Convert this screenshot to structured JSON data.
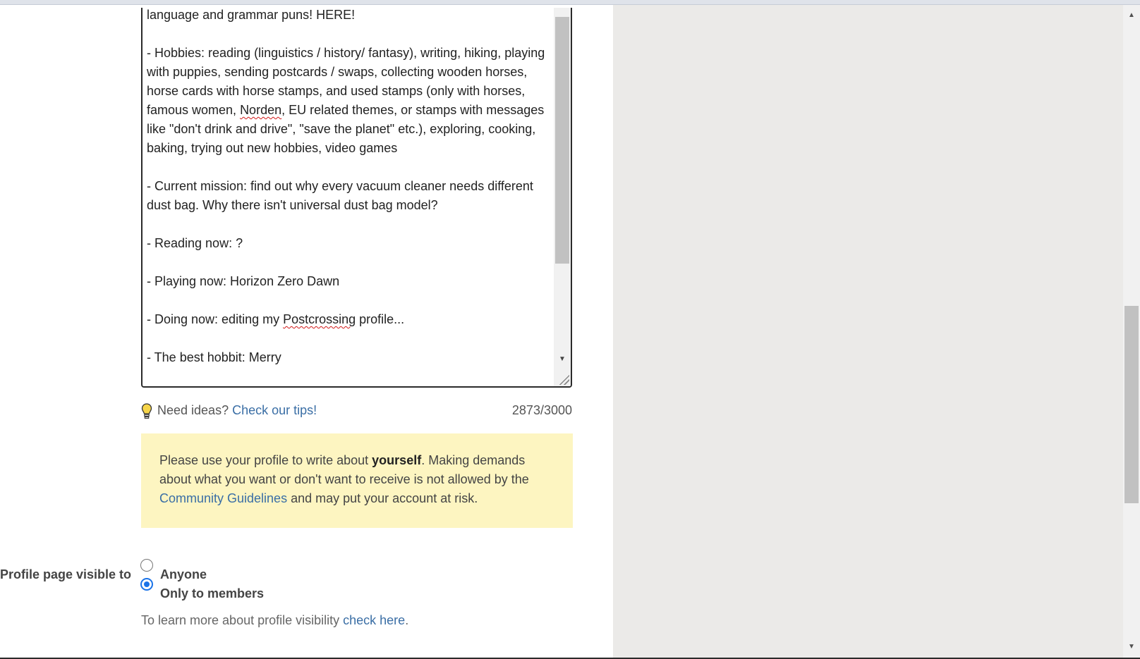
{
  "about_textarea": {
    "lines": [
      "language and grammar puns! HERE!",
      "",
      "- Hobbies: reading (linguistics / history/ fantasy), writing, hiking, playing",
      "with puppies, sending postcards / swaps, collecting wooden horses,",
      "horse cards with horse stamps, and used stamps (only with horses,"
    ],
    "line_famous_prefix": "famous women, ",
    "line_famous_misspelled": "Norden",
    "line_famous_suffix": ", EU related themes, or stamps with messages",
    "lines_2": [
      "like \"don't drink and drive\", \"save the planet\" etc.), exploring, cooking,",
      "baking, trying out new hobbies, video games",
      "",
      "- Current mission: find out why every vacuum cleaner needs different",
      "dust bag. Why there isn't universal dust bag model?",
      "",
      "- Reading now: ?",
      "",
      "- Playing now: Horizon Zero Dawn",
      ""
    ],
    "line_doing_prefix": "- Doing now: editing my ",
    "line_doing_misspelled": "Postcrossing",
    "line_doing_suffix": " profile...",
    "lines_3": [
      "",
      "- The best hobbit: Merry"
    ]
  },
  "hint": {
    "prefix": "Need ideas?",
    "link": "Check our tips!",
    "char_count": "2873/3000",
    "icon": "lightbulb-icon"
  },
  "notice": {
    "text_1": "Please use your profile to write about ",
    "text_bold": "yourself",
    "text_2": ". Making demands about what you want or don't want to receive is not allowed by the ",
    "link": "Community Guidelines",
    "text_3": " and may put your account at risk.",
    "background": "#fdf5c1"
  },
  "visibility": {
    "label": "Profile page visible to",
    "options": [
      {
        "label": "Anyone",
        "selected": false
      },
      {
        "label": "Only to members",
        "selected": true
      }
    ],
    "learn_prefix": "To learn more about profile visibility ",
    "learn_link": "check here",
    "learn_suffix": "."
  },
  "colors": {
    "link": "#3a6ea5",
    "radio_selected": "#1a73e8",
    "side_panel": "#ebeae8"
  }
}
